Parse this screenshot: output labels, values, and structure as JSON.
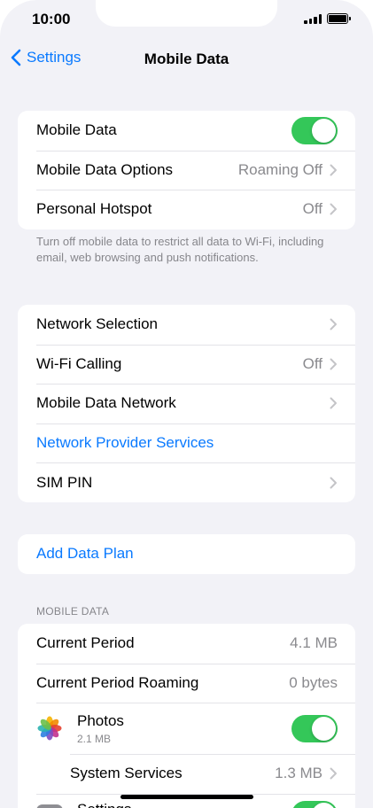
{
  "status_bar": {
    "time": "10:00"
  },
  "navbar": {
    "back_label": "Settings",
    "title": "Mobile Data"
  },
  "group1": {
    "mobile_data_label": "Mobile Data",
    "mobile_data_on": true,
    "options_label": "Mobile Data Options",
    "options_value": "Roaming Off",
    "hotspot_label": "Personal Hotspot",
    "hotspot_value": "Off"
  },
  "footnote1": "Turn off mobile data to restrict all data to Wi-Fi, including email, web browsing and push notifications.",
  "group2": {
    "network_selection_label": "Network Selection",
    "wifi_calling_label": "Wi-Fi Calling",
    "wifi_calling_value": "Off",
    "mobile_data_network_label": "Mobile Data Network",
    "provider_services_label": "Network Provider Services",
    "sim_pin_label": "SIM PIN"
  },
  "group3": {
    "add_data_plan_label": "Add Data Plan"
  },
  "section_header": "MOBILE DATA",
  "group4": {
    "current_period_label": "Current Period",
    "current_period_value": "4.1 MB",
    "roaming_label": "Current Period Roaming",
    "roaming_value": "0 bytes",
    "photos_name": "Photos",
    "photos_usage": "2.1 MB",
    "photos_on": true,
    "system_services_label": "System Services",
    "system_services_value": "1.3 MB",
    "settings_name": "Settings"
  },
  "colors": {
    "accent": "#0a7aff",
    "toggle_on": "#34c759",
    "background": "#f2f2f7"
  }
}
